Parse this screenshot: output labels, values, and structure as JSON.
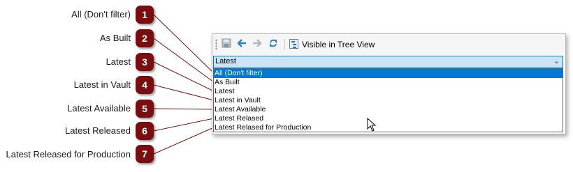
{
  "callouts": [
    {
      "number": "1",
      "label": "All (Don't filter)"
    },
    {
      "number": "2",
      "label": "As Built"
    },
    {
      "number": "3",
      "label": "Latest"
    },
    {
      "number": "4",
      "label": "Latest  in Vault"
    },
    {
      "number": "5",
      "label": "Latest Available"
    },
    {
      "number": "6",
      "label": "Latest Released"
    },
    {
      "number": "7",
      "label": "Latest Released for Production"
    }
  ],
  "toolbar": {
    "icons": [
      "save-icon",
      "back-arrow-icon",
      "forward-arrow-icon",
      "refresh-icon",
      "tree-view-icon"
    ],
    "visible_in_tree_view": "Visible in Tree View"
  },
  "combo": {
    "selected": "Latest",
    "options": [
      "All (Don't filter)",
      "As Built",
      "Latest",
      "Latest in Vault",
      "Latest Available",
      "Latest Relased",
      "Latest Relased for Production"
    ]
  },
  "colors": {
    "badge": "#7a0e0e",
    "selection": "#0078d7",
    "combo_background": "#cce4f7"
  }
}
